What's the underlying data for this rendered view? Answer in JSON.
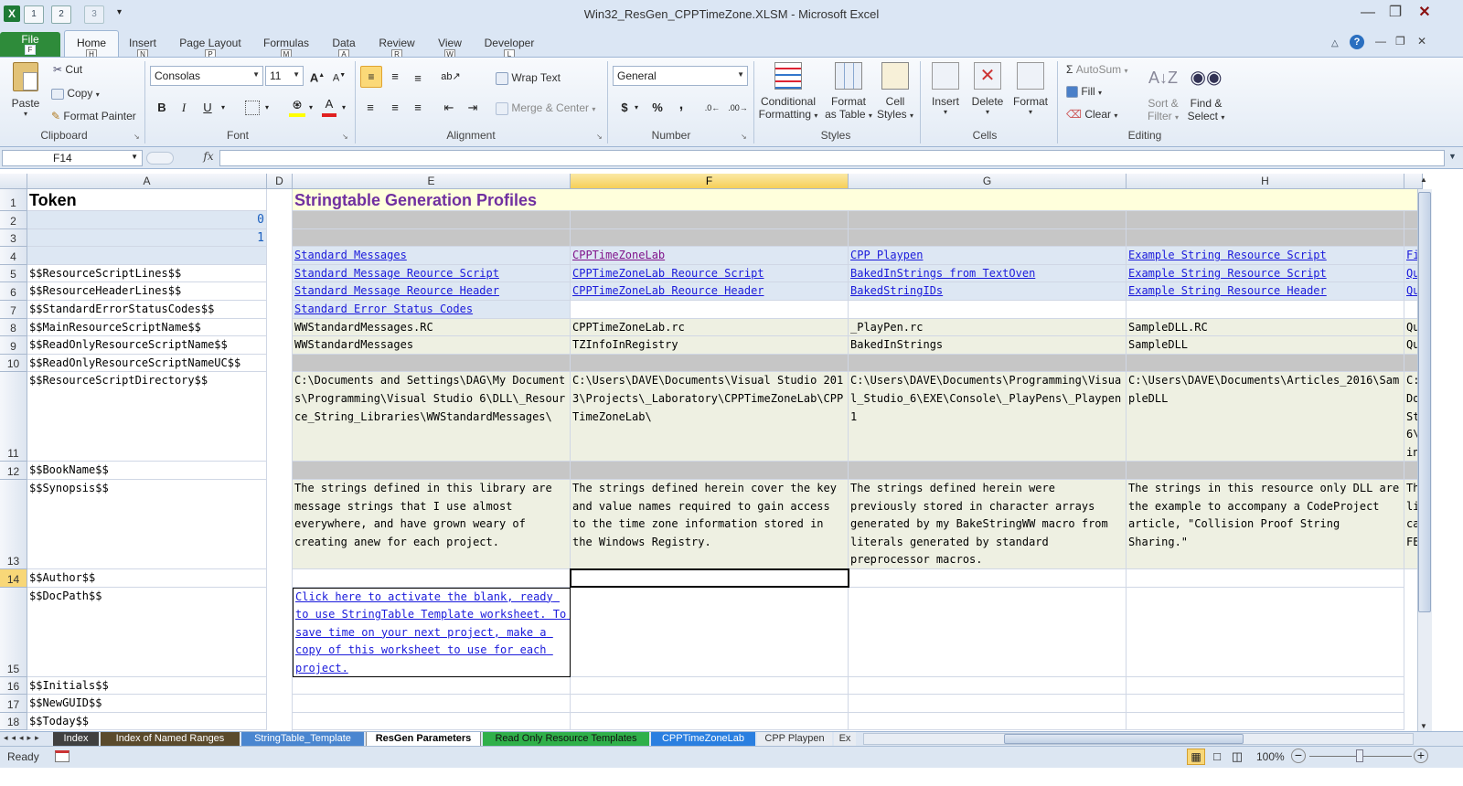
{
  "window": {
    "title": "Win32_ResGen_CPPTimeZone.XLSM  -  Microsoft Excel"
  },
  "qat": {
    "save": "1",
    "undo": "2",
    "redo": "3",
    "customize": "▾"
  },
  "tabs": [
    {
      "label": "File",
      "key": "F"
    },
    {
      "label": "Home",
      "key": "H"
    },
    {
      "label": "Insert",
      "key": "N"
    },
    {
      "label": "Page Layout",
      "key": "P"
    },
    {
      "label": "Formulas",
      "key": "M"
    },
    {
      "label": "Data",
      "key": "A"
    },
    {
      "label": "Review",
      "key": "R"
    },
    {
      "label": "View",
      "key": "W"
    },
    {
      "label": "Developer",
      "key": "L"
    }
  ],
  "ribbon": {
    "clipboard": {
      "paste": "Paste",
      "cut": "Cut",
      "copy": "Copy",
      "format_painter": "Format Painter",
      "label": "Clipboard"
    },
    "font": {
      "name": "Consolas",
      "size": "11",
      "label": "Font",
      "bold": "B",
      "italic": "I",
      "underline": "U"
    },
    "alignment": {
      "wrap": "Wrap Text",
      "merge": "Merge & Center",
      "label": "Alignment"
    },
    "number": {
      "format": "General",
      "label": "Number",
      "currency": "$",
      "percent": "%",
      "comma": ","
    },
    "styles": {
      "conditional": "Conditional",
      "conditional2": "Formatting",
      "format_table": "Format",
      "format_table2": "as Table",
      "cell_styles": "Cell",
      "cell_styles2": "Styles",
      "label": "Styles"
    },
    "cells": {
      "insert": "Insert",
      "delete": "Delete",
      "format": "Format",
      "label": "Cells"
    },
    "editing": {
      "autosum": "AutoSum",
      "fill": "Fill",
      "clear": "Clear",
      "sort": "Sort &",
      "sort2": "Filter",
      "find": "Find &",
      "find2": "Select",
      "label": "Editing"
    }
  },
  "formula_bar": {
    "name_box": "F14",
    "fx": "fx",
    "value": ""
  },
  "columns": [
    "A",
    "D",
    "E",
    "F",
    "G",
    "H"
  ],
  "rows": [
    "1",
    "2",
    "3",
    "4",
    "5",
    "6",
    "7",
    "8",
    "9",
    "10",
    "11",
    "12",
    "13",
    "14",
    "15",
    "16",
    "17",
    "18"
  ],
  "cells": {
    "a1": "Token",
    "e1": "Stringtable Generation Profiles",
    "a2": "0",
    "a3": "1",
    "e4": "Standard Messages",
    "f4": "CPPTimeZoneLab",
    "g4": "CPP Playpen",
    "h4": "Example String Resource Script",
    "i4": "Fi",
    "a5": "$$ResourceScriptLines$$",
    "e5": "Standard Message Reource Script",
    "f5": "CPPTimeZoneLab Reource Script",
    "g5": "BakedInStrings from TextOven",
    "h5": "Example String Resource Script",
    "i5": "Qu",
    "a6": "$$ResourceHeaderLines$$",
    "e6": "Standard Message Reource Header",
    "f6": "CPPTimeZoneLab Reource Header",
    "g6": "BakedStringIDs",
    "h6": "Example String Resource Header",
    "i6": "Qu",
    "a7": "$$StandardErrorStatusCodes$$",
    "e7": "Standard Error Status Codes",
    "a8": "$$MainResourceScriptName$$",
    "e8": "WWStandardMessages.RC",
    "f8": "CPPTimeZoneLab.rc",
    "g8": "_PlayPen.rc",
    "h8": "SampleDLL.RC",
    "i8": "Qu",
    "a9": "$$ReadOnlyResourceScriptName$$",
    "e9": "WWStandardMessages",
    "f9": "TZInfoInRegistry",
    "g9": "BakedInStrings",
    "h9": "SampleDLL",
    "i9": "Qu",
    "a10": "$$ReadOnlyResourceScriptNameUC$$",
    "a11": "$$ResourceScriptDirectory$$",
    "e11": "C:\\Documents and Settings\\DAG\\My Documents\\Programming\\Visual Studio 6\\DLL\\_Resource_String_Libraries\\WWStandardMessages\\",
    "f11": "C:\\Users\\DAVE\\Documents\\Visual Studio 2013\\Projects\\_Laboratory\\CPPTimeZoneLab\\CPPTimeZoneLab\\",
    "g11": "C:\\Users\\DAVE\\Documents\\Programming\\Visual_Studio_6\\EXE\\Console\\_PlayPens\\_Playpen1",
    "h11": "C:\\Users\\DAVE\\Documents\\Articles_2016\\SampleDLL",
    "i11": "C:\nDo\nSt\n6\\\nin",
    "a12": "$$BookName$$",
    "a13": "$$Synopsis$$",
    "e13": "The strings defined in this library are message strings that I use almost everywhere, and have grown weary of creating anew for each project.",
    "f13": "The strings defined herein cover the key and value names required to gain access to the time zone information stored in the Windows Registry.",
    "g13": "The strings defined herein were previously stored in character arrays generated by my BakeStringWW macro from literals generated by standard preprocessor macros.",
    "h13": "The strings in this resource only DLL are the example to accompany a CodeProject article, \"Collision Proof String Sharing.\"",
    "i13": "Th\nli\nca\nFE",
    "a14": "$$Author$$",
    "a15": "$$DocPath$$",
    "e15": "Click here to activate the blank, ready to use StringTable Template worksheet. To save time on your next project, make a copy of this worksheet to use for each project.",
    "a16": "$$Initials$$",
    "a17": "$$NewGUID$$",
    "a18": "$$Today$$"
  },
  "sheet_tabs": [
    "Index",
    "Index of Named Ranges",
    "StringTable_Template",
    "ResGen Parameters",
    "Read Only Resource Templates",
    "CPPTimeZoneLab",
    "CPP Playpen",
    "Ex"
  ],
  "status": {
    "mode": "Ready",
    "zoom": "100%"
  },
  "colors": {
    "accent_file_tab": "#2e8b3a",
    "title_purple": "#7030a0",
    "link": "#1a1adb",
    "cream": "#eef0e2",
    "selected_header": "#f6cf57"
  }
}
